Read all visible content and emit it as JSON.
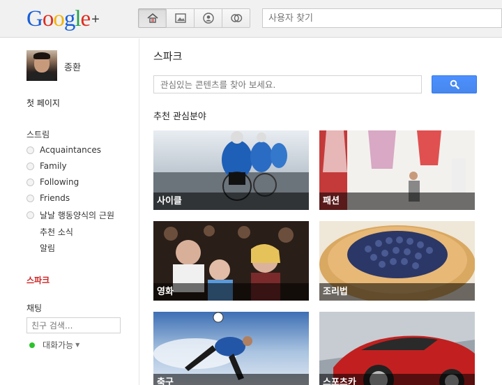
{
  "header": {
    "logo": {
      "word": "Google",
      "plus": "+"
    },
    "nav": [
      {
        "name": "home",
        "icon": "home-icon",
        "active": true
      },
      {
        "name": "photos",
        "icon": "photos-icon",
        "active": false
      },
      {
        "name": "profile",
        "icon": "profile-icon",
        "active": false
      },
      {
        "name": "circles",
        "icon": "circles-icon",
        "active": false
      }
    ],
    "search_placeholder": "사용자 찾기"
  },
  "sidebar": {
    "profile_name": "종환",
    "first_page": "첫 페이지",
    "stream_title": "스트림",
    "circles": [
      "Acquaintances",
      "Family",
      "Following",
      "Friends",
      "날날 행동양식의 근원"
    ],
    "extra_items": [
      "추천 소식",
      "알림"
    ],
    "sparks": "스파크",
    "chat_title": "채팅",
    "friend_search_placeholder": "친구 검색...",
    "chat_status": "대화가능"
  },
  "main": {
    "title": "스파크",
    "search_placeholder": "관심있는 콘텐츠를 찾아 보세요.",
    "section_heading": "추천 관심분야",
    "cards": [
      "사이클",
      "패션",
      "영화",
      "조리법",
      "축구",
      "스포츠카"
    ]
  },
  "colors": {
    "accent_blue": "#4d90fe",
    "sparks_red": "#cc2222",
    "online_green": "#2cc22c"
  }
}
